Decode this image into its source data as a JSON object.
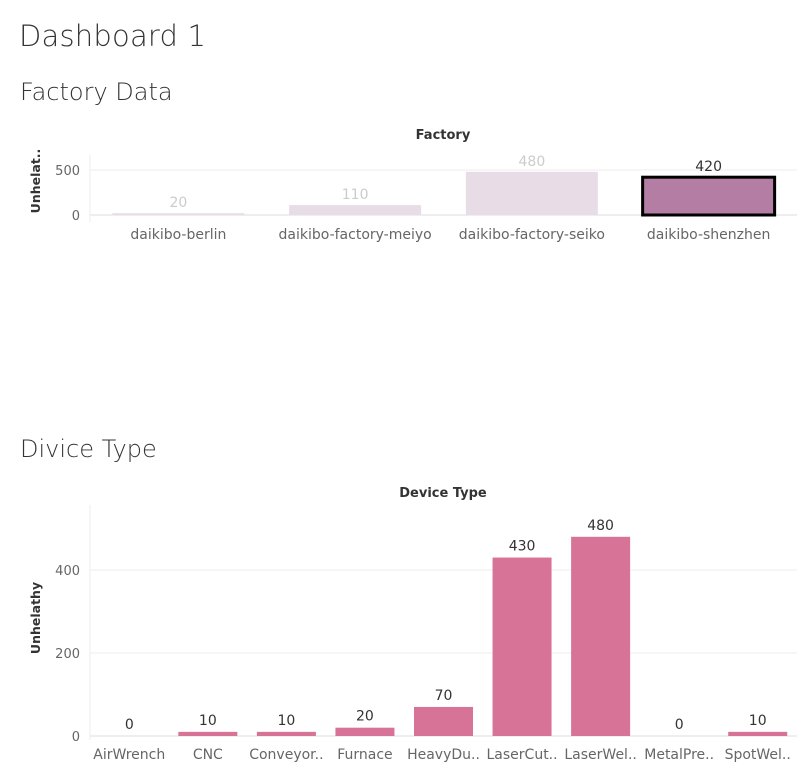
{
  "dashboard": {
    "title": "Dashboard 1"
  },
  "sections": {
    "factory": {
      "title": "Factory Data"
    },
    "device": {
      "title": "Divice Type"
    }
  },
  "colors": {
    "factory_dim": "#e8dde6",
    "factory_dim_label": "#cccccc",
    "factory_selected": "#b47da3",
    "factory_selected_border": "#000000",
    "device_bar": "#d67396",
    "label_dark": "#333333"
  },
  "chart_data": [
    {
      "type": "bar",
      "header": "Factory",
      "ylabel": "Unhelat..",
      "categories": [
        "daikibo-berlin",
        "daikibo-factory-meiyo",
        "daikibo-factory-seiko",
        "daikibo-shenzhen"
      ],
      "values": [
        20,
        110,
        480,
        420
      ],
      "value_labels": [
        "20",
        "110",
        "480",
        "420"
      ],
      "selected": "daikibo-shenzhen",
      "yticks": [
        "0",
        "500"
      ],
      "ytick_values": [
        0,
        500
      ],
      "ylim": [
        0,
        500
      ],
      "grid": true
    },
    {
      "type": "bar",
      "header": "Device Type",
      "ylabel": "Unhelathy",
      "categories": [
        "AirWrench",
        "CNC",
        "Conveyor..",
        "Furnace",
        "HeavyDu..",
        "LaserCut..",
        "LaserWel..",
        "MetalPre..",
        "SpotWel.."
      ],
      "values": [
        0,
        10,
        10,
        20,
        70,
        430,
        480,
        0,
        10
      ],
      "value_labels": [
        "0",
        "10",
        "10",
        "20",
        "70",
        "430",
        "480",
        "0",
        "10"
      ],
      "yticks": [
        "0",
        "200",
        "400"
      ],
      "ytick_values": [
        0,
        200,
        400
      ],
      "ylim": [
        0,
        480
      ],
      "grid": true
    }
  ]
}
